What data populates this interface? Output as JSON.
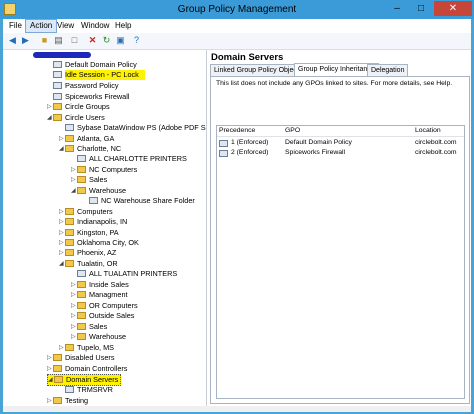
{
  "window": {
    "title": "Group Policy Management",
    "controls": {
      "minimize": "–",
      "maximize": "□",
      "close": "✕"
    }
  },
  "menubar": {
    "items": [
      "File",
      "Action",
      "View",
      "Window",
      "Help"
    ],
    "active": "Action"
  },
  "toolbar": {
    "buttons": [
      "back-arrow-icon",
      "forward-arrow-icon",
      "folder-up-icon",
      "properties-icon",
      "show-hide-tree-icon",
      "delete-icon",
      "refresh-icon",
      "export-icon",
      "help-icon"
    ]
  },
  "tree": {
    "items": [
      {
        "label": "Default Domain Policy",
        "type": "gpo"
      },
      {
        "label": "Idle Session - PC Lock",
        "type": "gpo",
        "highlight": true
      },
      {
        "label": "Password Policy",
        "type": "gpo"
      },
      {
        "label": "Spiceworks Firewall",
        "type": "gpo"
      },
      {
        "label": "Circle Groups",
        "type": "folder"
      },
      {
        "label": "Circle Users",
        "type": "folder"
      },
      {
        "label": "Sybase DataWindow PS (Adobe PDF Sa",
        "type": "gpo"
      },
      {
        "label": "Atlanta, GA",
        "type": "folder"
      },
      {
        "label": "Charlotte, NC",
        "type": "folder"
      },
      {
        "label": "ALL CHARLOTTE PRINTERS",
        "type": "gpo"
      },
      {
        "label": "NC Computers",
        "type": "folder"
      },
      {
        "label": "Sales",
        "type": "folder"
      },
      {
        "label": "Warehouse",
        "type": "folder"
      },
      {
        "label": "NC Warehouse Share Folder",
        "type": "gpo"
      },
      {
        "label": "Computers",
        "type": "folder"
      },
      {
        "label": "Indianapolis, IN",
        "type": "folder"
      },
      {
        "label": "Kingston, PA",
        "type": "folder"
      },
      {
        "label": "Oklahoma City, OK",
        "type": "folder"
      },
      {
        "label": "Phoenix, AZ",
        "type": "folder"
      },
      {
        "label": "Tualatin, OR",
        "type": "folder"
      },
      {
        "label": "ALL TUALATIN PRINTERS",
        "type": "gpo"
      },
      {
        "label": "Inside Sales",
        "type": "folder"
      },
      {
        "label": "Managment",
        "type": "folder"
      },
      {
        "label": "OR Computers",
        "type": "folder"
      },
      {
        "label": "Outside Sales",
        "type": "folder"
      },
      {
        "label": "Sales",
        "type": "folder"
      },
      {
        "label": "Warehouse",
        "type": "folder"
      },
      {
        "label": "Tupelo, MS",
        "type": "folder"
      },
      {
        "label": "Disabled Users",
        "type": "folder"
      },
      {
        "label": "Domain Controllers",
        "type": "folder"
      },
      {
        "label": "Domain Servers",
        "type": "folder",
        "highlight": true,
        "selected": true
      },
      {
        "label": "TRMSRVR",
        "type": "gpo"
      },
      {
        "label": "Testing",
        "type": "folder"
      }
    ]
  },
  "details": {
    "title": "Domain Servers",
    "tabs": [
      "Linked Group Policy Objects",
      "Group Policy Inheritance",
      "Delegation"
    ],
    "active_tab": "Group Policy Inheritance",
    "note": "This list does not include any GPOs linked to sites. For more details, see Help.",
    "columns": [
      "Precedence",
      "GPO",
      "Location"
    ],
    "rows": [
      {
        "precedence": "1 (Enforced)",
        "gpo": "Default Domain Policy",
        "location": "circlebolt.com"
      },
      {
        "precedence": "2 (Enforced)",
        "gpo": "Spiceworks Firewall",
        "location": "circlebolt.com"
      }
    ]
  },
  "colors": {
    "title_bar": "#3a9bd8",
    "highlight": "#fff200",
    "redaction": "#1d27b8",
    "close": "#c7463a"
  }
}
